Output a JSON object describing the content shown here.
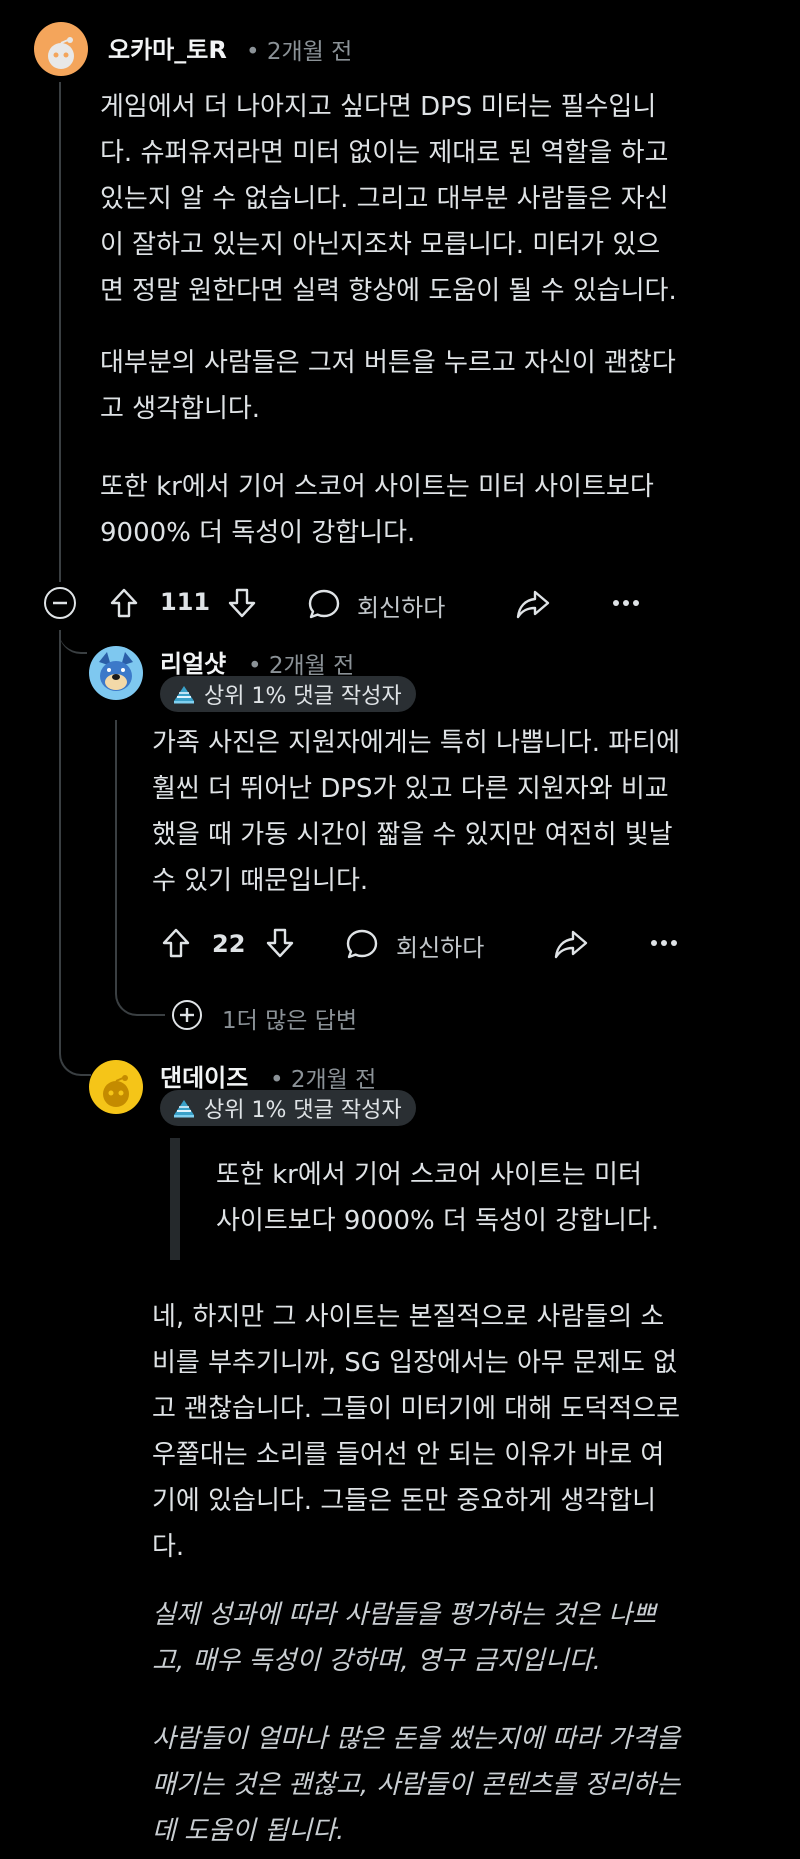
{
  "comment1": {
    "username": "오카마_토R",
    "time": "• 2개월 전",
    "paragraphs": [
      "게임에서 더 나아지고 싶다면 DPS 미터는 필수입니\n다. 슈퍼유저라면 미터 없이는 제대로 된 역할을 하고\n있는지 알 수 없습니다. 그리고 대부분 사람들은 자신\n이 잘하고 있는지 아닌지조차 모릅니다. 미터가 있으\n면 정말 원한다면 실력 향상에 도움이 될 수 있습니다.",
      "대부분의 사람들은 그저 버튼을 누르고 자신이 괜찮다\n고 생각합니다.",
      "또한 kr에서 기어 스코어 사이트는 미터 사이트보다\n9000% 더 독성이 강합니다."
    ],
    "votes": "111",
    "reply_label": "회신하다",
    "collapse_icon": "minus-circle-icon",
    "avatar_color": "#f4a55b"
  },
  "reply1": {
    "username": "리얼샷",
    "time": "• 2개월 전",
    "badge": "상위 1% 댓글 작성자",
    "paragraph": "가족 사진은 지원자에게는 특히 나쁩니다. 파티에\n훨씬 더 뛰어난 DPS가 있고 다른 지원자와 비교\n했을 때 가동 시간이 짧을 수 있지만 여전히 빛날\n수 있기 때문입니다.",
    "votes": "22",
    "reply_label": "회신하다",
    "more_replies": "1더 많은 답변",
    "avatar_color": "#7ec8f0"
  },
  "reply2": {
    "username": "댄데이즈",
    "time": "• 2개월 전",
    "badge": "상위 1% 댓글 작성자",
    "quote": "또한 kr에서 기어 스코어 사이트는 미터\n사이트보다 9000% 더 독성이 강합니다.",
    "paragraph": "네, 하지만 그 사이트는 본질적으로 사람들의 소\n비를 부추기니까, SG 입장에서는 아무 문제도 없\n고 괜찮습니다. 그들이 미터기에 대해 도덕적으로\n우쭐대는 소리를 들어선 안 되는 이유가 바로 여\n기에 있습니다. 그들은 돈만 중요하게 생각합니\n다.",
    "italic1": "실제 성과에 따라 사람들을 평가하는 것은 나쁘\n고, 매우 독성이 강하며, 영구 금지입니다.",
    "italic2": "사람들이 얼마나 많은 돈을 썼는지에 따라 가격을\n매기는 것은 괜찮고, 사람들이 콘텐츠를 정리하는\n데 도움이 됩니다.",
    "avatar_color": "#f5c518"
  },
  "icons": {
    "upvote": "upvote-arrow-icon",
    "downvote": "downvote-arrow-icon",
    "reply": "speech-bubble-icon",
    "share": "share-arrow-icon",
    "more": "more-dots-icon",
    "badge": "top-commenter-icon",
    "expand": "plus-circle-icon"
  }
}
